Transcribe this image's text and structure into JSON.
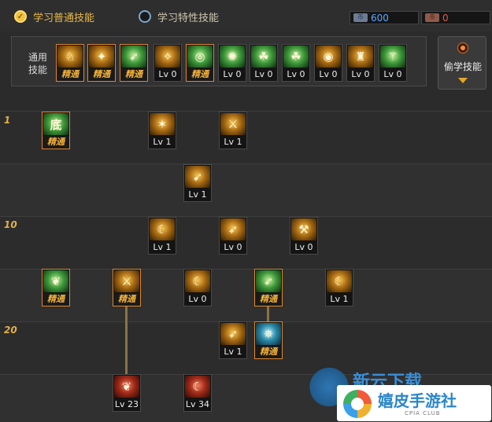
{
  "tabs": {
    "normal": "学习普通技能",
    "special": "学习特性技能"
  },
  "currencies": {
    "blue": {
      "icon": "币",
      "value": "600"
    },
    "red": {
      "icon": "币",
      "value": "0"
    }
  },
  "common_panel": {
    "label_line1": "通用",
    "label_line2": "技能",
    "skills": [
      {
        "tag": "精通",
        "glyph": "♘"
      },
      {
        "tag": "精通",
        "glyph": "✦"
      },
      {
        "tag": "精通",
        "glyph": "➶"
      },
      {
        "tag": "Lv 0",
        "glyph": "✧"
      },
      {
        "tag": "精通",
        "glyph": "◎"
      },
      {
        "tag": "Lv 0",
        "glyph": "✺"
      },
      {
        "tag": "Lv 0",
        "glyph": "☘"
      },
      {
        "tag": "Lv 0",
        "glyph": "☘"
      },
      {
        "tag": "Lv 0",
        "glyph": "◉"
      },
      {
        "tag": "Lv 0",
        "glyph": "♜"
      },
      {
        "tag": "Lv 0",
        "glyph": "⚚"
      }
    ]
  },
  "steal_skill": {
    "label": "偷学技能"
  },
  "level_markers": [
    "1",
    "10",
    "20"
  ],
  "tree": {
    "row1": [
      {
        "tag": "精通",
        "glyph": "底"
      },
      {
        "tag": "Lv 1",
        "glyph": "✶"
      },
      {
        "tag": "Lv 1",
        "glyph": "⚔"
      }
    ],
    "row2": [
      {
        "tag": "Lv 1",
        "glyph": "➹"
      }
    ],
    "row3": [
      {
        "tag": "Lv 1",
        "glyph": "☾"
      },
      {
        "tag": "Lv 0",
        "glyph": "➶"
      },
      {
        "tag": "Lv 0",
        "glyph": "⚒"
      }
    ],
    "row4": [
      {
        "tag": "精通",
        "glyph": "❦"
      },
      {
        "tag": "精通",
        "glyph": "⚔"
      },
      {
        "tag": "Lv 0",
        "glyph": "☾"
      },
      {
        "tag": "精通",
        "glyph": "➶"
      },
      {
        "tag": "Lv 1",
        "glyph": "☾"
      }
    ],
    "row5": [
      {
        "tag": "Lv 1",
        "glyph": "➶"
      },
      {
        "tag": "精通",
        "glyph": "✵"
      }
    ],
    "row6": [
      {
        "tag": "Lv 23",
        "glyph": "❦"
      },
      {
        "tag": "Lv 34",
        "glyph": "☾"
      }
    ]
  },
  "watermark": {
    "main": "嬉皮手游社",
    "sub": "CPIA CLUB",
    "bg_text": "新云下载"
  }
}
